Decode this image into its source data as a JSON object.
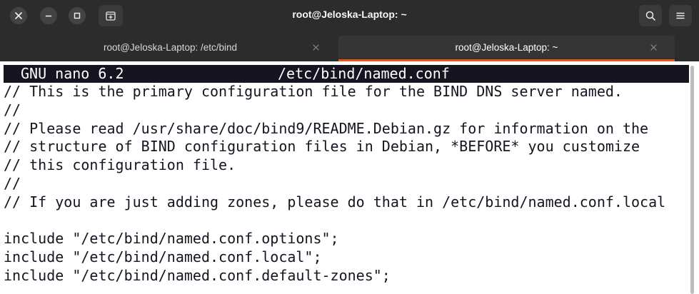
{
  "window": {
    "title": "root@Jeloska-Laptop: ~"
  },
  "titlebar": {
    "close_icon": "close-icon",
    "minimize_icon": "minimize-icon",
    "maximize_icon": "maximize-icon",
    "new_tab_icon": "new-tab-icon",
    "search_icon": "search-icon",
    "menu_icon": "hamburger-menu-icon"
  },
  "tabs": [
    {
      "label": "root@Jeloska-Laptop: /etc/bind",
      "active": false
    },
    {
      "label": "root@Jeloska-Laptop: ~",
      "active": true
    }
  ],
  "colors": {
    "accent": "#e95420",
    "titlebar_bg": "#2c2c2c",
    "terminal_bg": "#ffffff",
    "terminal_fg": "#171421",
    "header_bg": "#171421"
  },
  "nano": {
    "version": "GNU nano 6.2",
    "filename": "/etc/bind/named.conf",
    "lines": [
      "// This is the primary configuration file for the BIND DNS server named.",
      "//",
      "// Please read /usr/share/doc/bind9/README.Debian.gz for information on the",
      "// structure of BIND configuration files in Debian, *BEFORE* you customize",
      "// this configuration file.",
      "//",
      "// If you are just adding zones, please do that in /etc/bind/named.conf.local",
      "",
      "include \"/etc/bind/named.conf.options\";",
      "include \"/etc/bind/named.conf.local\";",
      "include \"/etc/bind/named.conf.default-zones\";"
    ]
  }
}
